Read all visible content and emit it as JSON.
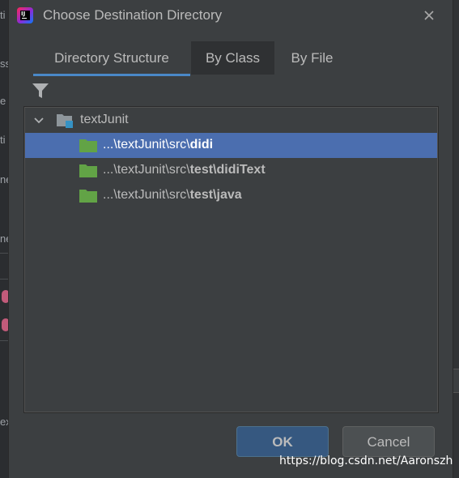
{
  "dialog": {
    "title": "Choose Destination Directory",
    "app_icon_text": "IJ"
  },
  "tabs": [
    {
      "label": "Directory Structure",
      "active": true
    },
    {
      "label": "By Class",
      "active": false
    },
    {
      "label": "By File",
      "active": false
    }
  ],
  "tree": {
    "root": {
      "label": "textJunit",
      "expanded": true
    },
    "items": [
      {
        "prefix": "...\\textJunit\\src\\",
        "bold": "didi",
        "selected": true
      },
      {
        "prefix": "...\\textJunit\\src\\",
        "bold": "test\\didiText",
        "selected": false
      },
      {
        "prefix": "...\\textJunit\\src\\",
        "bold": "test\\java",
        "selected": false
      }
    ]
  },
  "buttons": {
    "ok": "OK",
    "cancel": "Cancel"
  },
  "watermark": "https://blog.csdn.net/Aaronszh",
  "background_ide": {
    "fragments": [
      "ti",
      "ss",
      "e",
      "ti",
      "ne",
      "ne",
      "ex"
    ]
  },
  "colors": {
    "dialog_bg": "#3c3f41",
    "selection": "#4b6eaf",
    "tab_underline": "#4a88c7",
    "ok_button": "#365880",
    "folder_green": "#62a346"
  }
}
